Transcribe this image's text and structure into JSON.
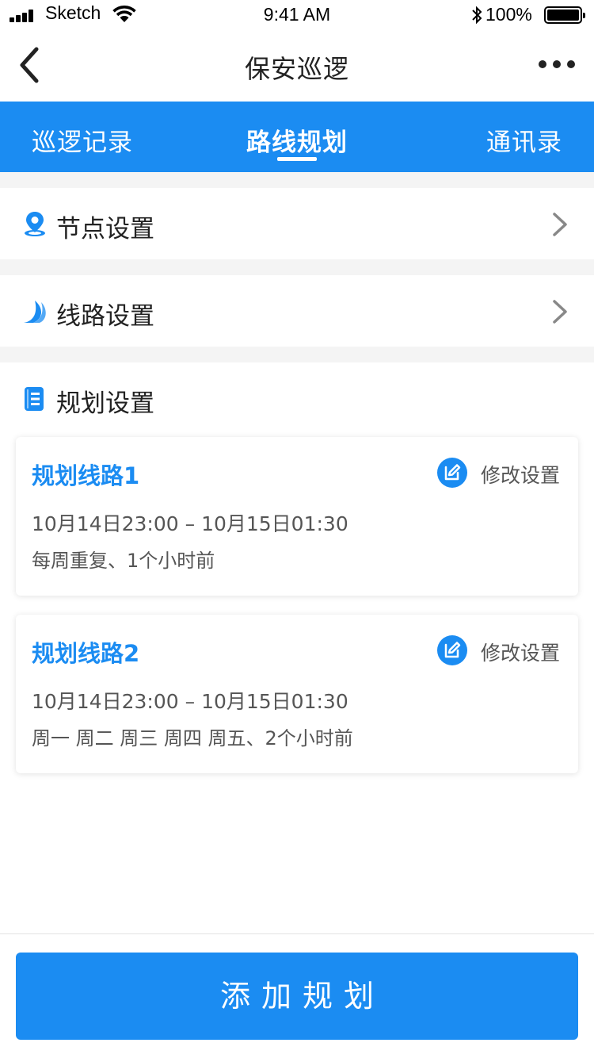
{
  "status_bar": {
    "carrier": "Sketch",
    "time": "9:41 AM",
    "battery": "100%"
  },
  "nav": {
    "title": "保安巡逻",
    "back_icon": "chevron-left-icon",
    "more_icon": "more-horizontal-icon"
  },
  "tabs": [
    {
      "label": "巡逻记录",
      "active": false
    },
    {
      "label": "路线规划",
      "active": true
    },
    {
      "label": "通讯录",
      "active": false
    }
  ],
  "settings": [
    {
      "label": "节点设置",
      "icon": "location-pin-icon"
    },
    {
      "label": "线路设置",
      "icon": "route-icon"
    }
  ],
  "plan_section": {
    "label": "规划设置",
    "icon": "plan-document-icon",
    "cards": [
      {
        "title": "规划线路1",
        "edit_label": "修改设置",
        "time": "10月14日23:00 – 10月15日01:30",
        "repeat": "每周重复、1个小时前"
      },
      {
        "title": "规划线路2",
        "edit_label": "修改设置",
        "time": "10月14日23:00 – 10月15日01:30",
        "repeat": "周一 周二 周三 周四 周五、2个小时前"
      }
    ]
  },
  "add_button": "添加规划",
  "colors": {
    "accent": "#1b8cf2",
    "background": "#f4f4f4",
    "text": "#222222",
    "secondary_text": "#555555"
  }
}
